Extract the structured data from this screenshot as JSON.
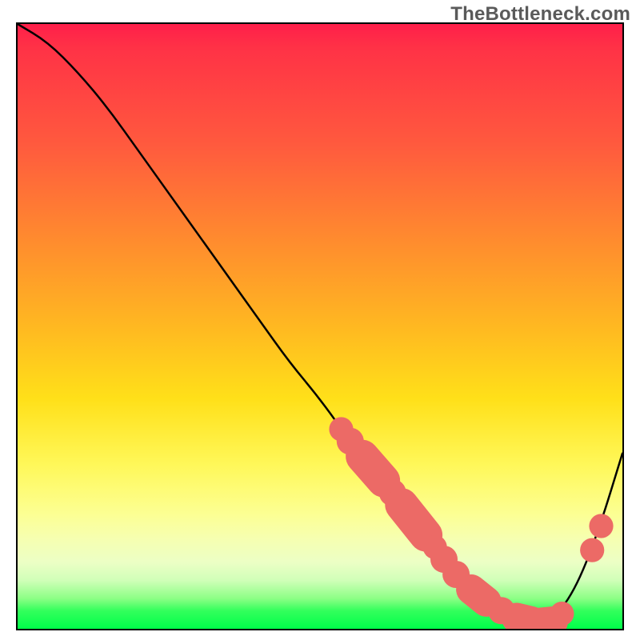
{
  "watermark": "TheBottleneck.com",
  "chart_data": {
    "type": "line",
    "title": "",
    "xlabel": "",
    "ylabel": "",
    "xlim": [
      0,
      100
    ],
    "ylim": [
      0,
      100
    ],
    "grid": false,
    "legend": false,
    "series": [
      {
        "name": "curve",
        "x": [
          0,
          5,
          10,
          15,
          20,
          25,
          30,
          35,
          40,
          45,
          50,
          55,
          60,
          65,
          70,
          75,
          80,
          85,
          88,
          92,
          96,
          100
        ],
        "y": [
          100,
          97,
          92,
          86,
          79,
          72,
          65,
          58,
          51,
          44,
          38,
          31,
          25,
          18,
          12,
          7,
          3,
          1,
          1,
          6,
          16,
          29
        ],
        "stroke": "#000000",
        "stroke_width": 2
      }
    ],
    "markers": [
      {
        "shape": "dot",
        "x": 53.5,
        "y": 33.0,
        "r": 4.0,
        "color": "#ec6a66"
      },
      {
        "shape": "dot",
        "x": 55.0,
        "y": 31.0,
        "r": 4.5,
        "color": "#ec6a66"
      },
      {
        "shape": "capsule",
        "x1": 57.0,
        "y1": 28.5,
        "x2": 60.5,
        "y2": 24.5,
        "r": 5.5,
        "color": "#ec6a66"
      },
      {
        "shape": "dot",
        "x": 62.0,
        "y": 22.5,
        "r": 4.5,
        "color": "#ec6a66"
      },
      {
        "shape": "capsule",
        "x1": 63.5,
        "y1": 20.5,
        "x2": 67.5,
        "y2": 15.5,
        "r": 5.5,
        "color": "#ec6a66"
      },
      {
        "shape": "dot",
        "x": 69.0,
        "y": 13.5,
        "r": 4.0,
        "color": "#ec6a66"
      },
      {
        "shape": "dot",
        "x": 70.5,
        "y": 11.5,
        "r": 4.5,
        "color": "#ec6a66"
      },
      {
        "shape": "dot",
        "x": 72.5,
        "y": 9.0,
        "r": 4.5,
        "color": "#ec6a66"
      },
      {
        "shape": "capsule",
        "x1": 75.0,
        "y1": 6.5,
        "x2": 77.5,
        "y2": 4.5,
        "r": 5.0,
        "color": "#ec6a66"
      },
      {
        "shape": "dot",
        "x": 80.0,
        "y": 3.0,
        "r": 4.5,
        "color": "#ec6a66"
      },
      {
        "shape": "capsule",
        "x1": 82.5,
        "y1": 1.8,
        "x2": 85.0,
        "y2": 1.2,
        "r": 5.0,
        "color": "#ec6a66"
      },
      {
        "shape": "capsule",
        "x1": 86.5,
        "y1": 1.0,
        "x2": 88.5,
        "y2": 1.2,
        "r": 5.0,
        "color": "#ec6a66"
      },
      {
        "shape": "dot",
        "x": 90.0,
        "y": 2.5,
        "r": 4.0,
        "color": "#ec6a66"
      },
      {
        "shape": "dot",
        "x": 95.0,
        "y": 13.0,
        "r": 4.0,
        "color": "#ec6a66"
      },
      {
        "shape": "dot",
        "x": 96.5,
        "y": 17.0,
        "r": 4.0,
        "color": "#ec6a66"
      }
    ]
  }
}
